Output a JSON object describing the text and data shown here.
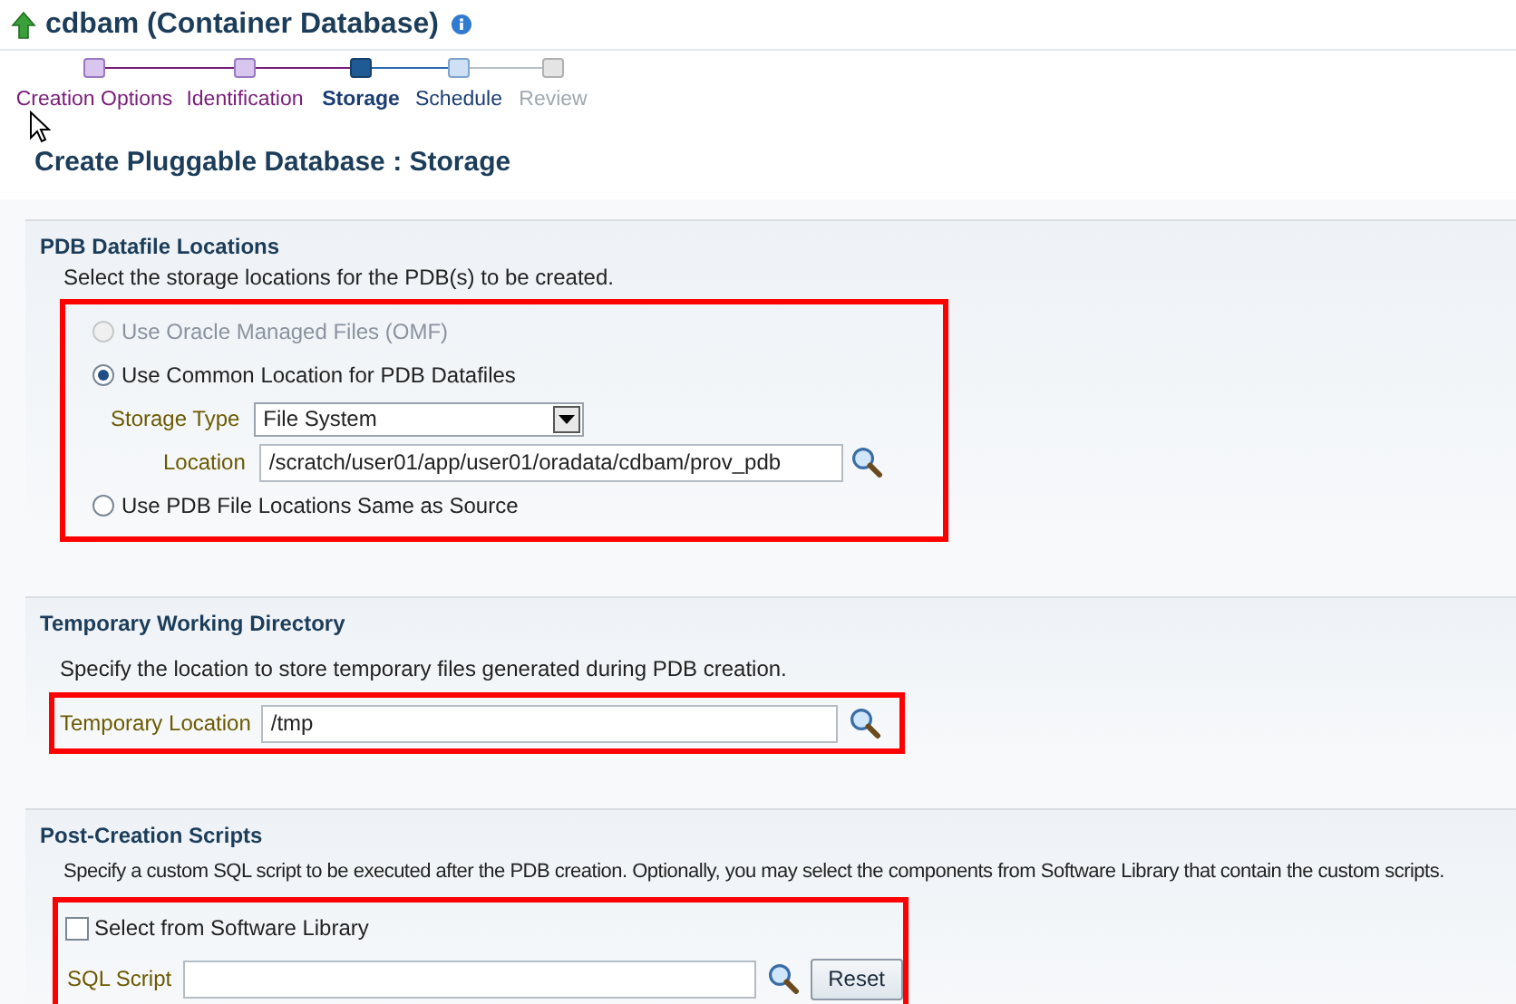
{
  "page_title": "cdbam (Container Database)",
  "train": [
    {
      "label": "Creation Options",
      "visited": true,
      "selected": false,
      "disabled": false
    },
    {
      "label": "Identification",
      "visited": true,
      "selected": false,
      "disabled": false
    },
    {
      "label": "Storage",
      "visited": false,
      "selected": true,
      "disabled": false
    },
    {
      "label": "Schedule",
      "visited": false,
      "selected": false,
      "disabled": false
    },
    {
      "label": "Review",
      "visited": false,
      "selected": false,
      "disabled": true
    }
  ],
  "heading": "Create Pluggable Database : Storage",
  "datafile_section": {
    "title": "PDB Datafile Locations",
    "description": "Select the storage locations for the PDB(s) to be created.",
    "options": [
      {
        "label": "Use Oracle Managed Files (OMF)",
        "selected": false,
        "disabled": true
      },
      {
        "label": "Use Common Location for PDB Datafiles",
        "selected": true,
        "disabled": false
      },
      {
        "label": "Use PDB File Locations Same as Source",
        "selected": false,
        "disabled": false
      }
    ],
    "storage_type": {
      "label": "Storage Type",
      "value": "File System"
    },
    "location": {
      "label": "Location",
      "value": "/scratch/user01/app/user01/oradata/cdbam/prov_pdb"
    }
  },
  "temp_section": {
    "title": "Temporary Working Directory",
    "description": "Specify the location to store temporary files generated during PDB creation.",
    "location": {
      "label": "Temporary Location",
      "value": "/tmp"
    }
  },
  "scripts_section": {
    "title": "Post-Creation Scripts",
    "description": "Specify a custom SQL script to be executed after the PDB creation. Optionally, you may select the components from Software Library that contain the custom scripts.",
    "library": {
      "label": "Select from Software Library",
      "checked": false
    },
    "sql_script": {
      "label": "SQL Script"
    },
    "reset_button": "Reset"
  }
}
